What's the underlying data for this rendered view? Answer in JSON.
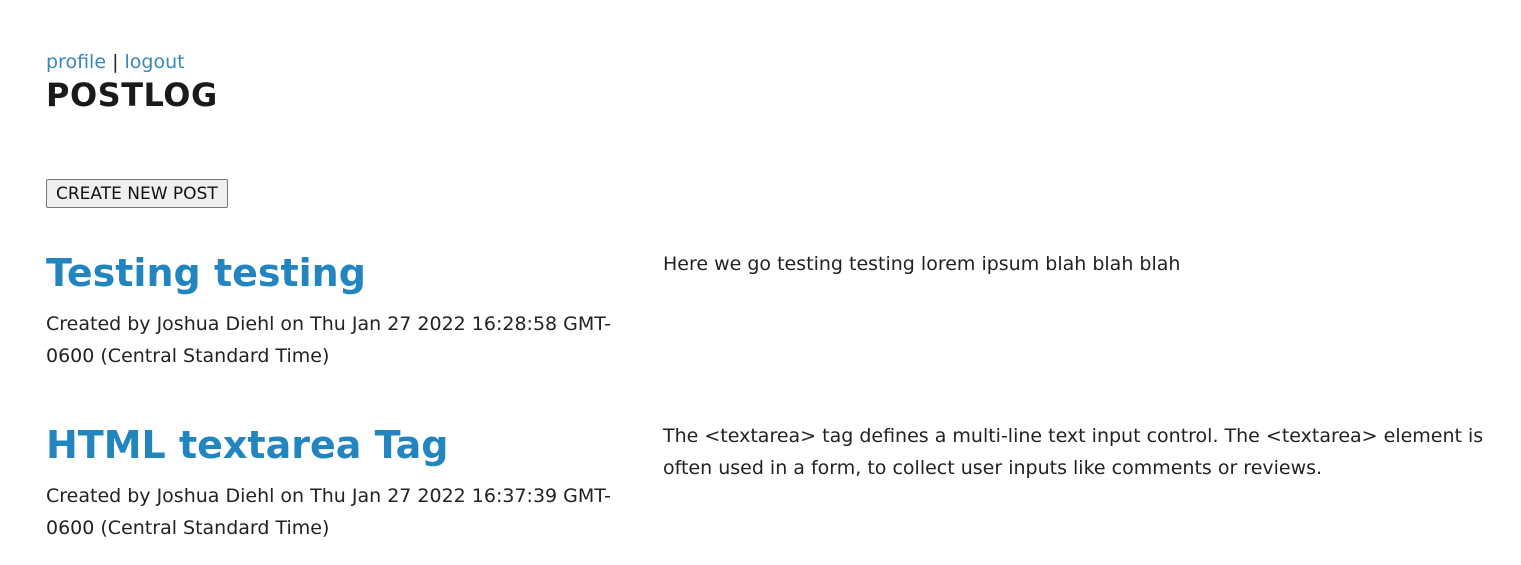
{
  "nav": {
    "profile_label": "profile",
    "separator": "|",
    "logout_label": "logout"
  },
  "brand": {
    "title": "POSTLOG"
  },
  "actions": {
    "create_post_label": "CREATE NEW POST"
  },
  "posts": [
    {
      "title": "Testing testing",
      "meta": "Created by Joshua Diehl on Thu Jan 27 2022 16:28:58 GMT-0600 (Central Standard Time)",
      "body": "Here we go testing testing lorem ipsum blah blah blah"
    },
    {
      "title": "HTML textarea Tag",
      "meta": "Created by Joshua Diehl on Thu Jan 27 2022 16:37:39 GMT-0600 (Central Standard Time)",
      "body": "The <textarea> tag defines a multi-line text input control. The <textarea> element is often used in a form, to collect user inputs like comments or reviews."
    }
  ],
  "colors": {
    "link": "#3a87b9",
    "post_title": "#2385bf",
    "text": "#222222"
  }
}
